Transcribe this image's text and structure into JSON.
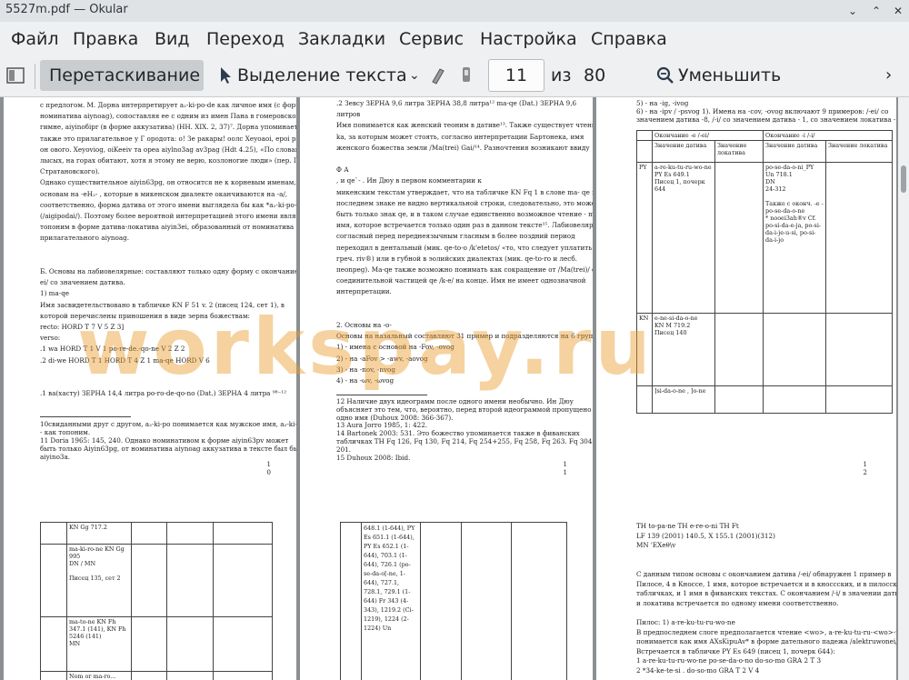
{
  "window": {
    "title": "5527m.pdf — Okular"
  },
  "menu": [
    "Файл",
    "Правка",
    "Вид",
    "Переход",
    "Закладки",
    "Сервис",
    "Настройка",
    "Справка"
  ],
  "toolbar": {
    "drag": "Перетаскивание",
    "select_text": "Выделение текста",
    "page_current": "11",
    "page_of": "из",
    "page_total": "80",
    "zoom_out": "Уменьшить"
  },
  "watermark": "workspay.ru",
  "pages": {
    "p1": {
      "lines": [
        "с предлогом. М. Дорна интерпретирует a₂-ki-po-de как личное имя (с формой",
        "номинатива aiynoag), сопоставляя ее с одним из имен Пана в гомеровском",
        "гимне, aiyinoбipr (в форме аккузатива) (HH. XIX. 2, 37)⁷. Дорна упоминает",
        "также это прилагательное у Г ородота: о! Зе ракары! оолс Хеуоаоі, ероі рєv",
        "он ового. Xeyoviog, oiKeeiv та ореа aiylno3ag av3pag (Hdt 4.25), «По словам",
        "лысых, на горах обитают, хотя я этому не верю, козлоногие люди» (пер. Г.А.",
        "Стратановского).",
        "Однако существительное aiyin63pg, он относится не к корневым именам, а к",
        "основам на -eH₂- , которые в микенском диалекте оканчиваются на -a/,",
        "соответственно, форма датива от этого имени выглядела бы как *a₂-ki-po-da",
        "(/aigipodai/). Поэтому более вероятной интерпретацией этого имени является",
        "топоним в форме датива-локатива aiyin3ei, образованный от номинатива",
        "прилагательного aiynoag.",
        "",
        "",
        "Б. Основы на лабиовелярные: составляют только одну форму с окончанием /-",
        "ei/ со значением датива.",
        "1) ma-qe",
        "Имя засвидетельствовано в табличке KN F 51 v. 2 (писец 124, сет 1), в",
        "которой перечислены приношения в виде зерна божествам:",
        "recto:        HORD T 7 V 5 Z 3]",
        "verso:",
        ".1        wa HORD T 1 V 1              po-re-de.-qo-ne    V 2 Z 2",
        ".2 di-we HORD T 1 HORD T 4 Z 1 ma-qe HORD V 6",
        "",
        "",
        ".1 ва(хасту) ЗЕРНА 14,4 литра po-ro-de-qo-no (Dat.) ЗЕРНА 4 литра ⁹⁸⁻¹²"
      ],
      "notes": [
        "10свиданными друг с другом, a₂-ki-po понимается как мужское имя, a₂-ki-po-de",
        "- как топоним.",
        "11      Doria 1965: 145, 240. Однако номинативом к форме aiyin63pv может",
        "быть только Aiyin63pg, от номинатива aiynoag аккузатива в тексте был бы",
        "aiyino3a."
      ],
      "page_number": [
        "1",
        "0"
      ]
    },
    "p2": {
      "lines": [
        ".2 Зевсу ЗЕРНА 9,6 литра ЗЕРНА 38,8 литра¹²         ma-qe       (Dat.) ЗЕРНА 9,6",
        "литров",
        "Имя понимается как женский теоним в дативе¹³. Также существует чтение ma-",
        "ka, за которым может стоять, согласно интерпретации Бартонека, имя",
        "женского божества земли /Ma(trei) Gai/¹⁴. Разночтения возникают ввиду",
        "",
        "                           Ф           А",
        "              ,                               и qe`-        . Ин Дюу в первом комментарии к",
        "микенским текстам утверждает, что на табличке KN Fq 1 в слове ma- qe в",
        "последнем знаке не видно вертикальной строки, следовательно, это может",
        "быть только знак qe, и в таком случае единственно возможное чтение - ma-qe,",
        "имя, которое встречается только один раз в данном тексте¹⁵. Лабиовелярный",
        "согласный перед переднеязычным гласным в более поздний период",
        "переходил в дентальный (мик. qe-to-o /k'etetos/ «то, что следует уплатить» и",
        "греч. riv®) или в губной в эолийских диалектах (мик. qe-to-ro и лесб.",
        "πeonpeg). Ма-qe также возможно понимать как сокращение от /Ma(trei)/ с",
        "соединительной частицей qe /k-e/ на конце. Имя не имеет однозначной",
        "интерпретации.",
        "",
        "",
        "2.   Основы на -o-",
        "Основы на назальный составляют 31 пример и подразделяются на 6 групп:",
        "1) - имена с основой на -Fov, -ovog",
        "2)       - на -aFov > -awv, -aovog",
        "3)       - на -nov, -nvog",
        "4)       - на -ωv, -ωvog"
      ],
      "notes": [
        "12      Наличие двух идеограмм после одного имени необычно. Ин Дюу",
        "объясняет это тем, что, вероятно, перед второй идеограммой пропущено еще",
        "одно имя (Duhoux 2008: 366-367).",
        "13      Aura Jorro 1985, 1: 422.",
        "14      Bartonek 2003: 531. Это божество упоминается также в фиванских",
        "табличках TH Fq 126, Fq 130, Fq 214, Fq 254+255, Fq 258, Fq 263. Fq 304, Gp",
        "201.",
        "15      Duhoux 2008: Ibid."
      ],
      "page_number": [
        "1",
        "1"
      ]
    },
    "p3": {
      "lines": [
        "5)   - на -ig, -ivog",
        "6)   - на -ipv / -psvog 1). Имена на -cov, -ovog  включают 9 примеров: /-ei/ со",
        "значением датива -8, /-i/ со значением датива - 1, со значением локатива - 1."
      ],
      "table": {
        "head1": [
          "",
          "Окончание -e /-ei/",
          "",
          "Окончание -i /-i/",
          ""
        ],
        "head2": [
          "",
          "Значение датива",
          "Значение локатива",
          "Значение датива",
          "Значение локатива"
        ],
        "row1": [
          "PY",
          "a-re-ku-tu-ru-wo-ne\nPY Es 649.1\nПисец 1, почерк 644",
          "",
          "po-se-da-o-ni_PY Un 718.1\nDN\n24-312\n\nТакже с оконч. -e - po-se-da-o-ne\n* nooei3ah®v Cf. po-si-da-e-ja, po-si-da-i-je-u-si, po-si-da-i-jo",
          ""
        ],
        "row2": [
          "KN",
          "e-ne-si-da-o-ne\nKN M 719.2\nПисец 140",
          "",
          "",
          ""
        ],
        "row3": [
          "",
          "]si-da-o-ne , ]o-ne",
          "",
          "",
          ""
        ]
      },
      "page_number": [
        "1",
        "2"
      ]
    },
    "p4": {
      "cells": [
        "KN Gg 717.2",
        "ma-ki-ro-ne KN Gg 995\nDN / MN\n\nПисец 135, сет 2",
        "ma-to-ne KN Fh 347.1 (141), KN Fh 5246 (141)\nMN",
        "Nom or ma-ro..."
      ]
    },
    "p5": {
      "cells": [
        "648.1 (1-644), PY Es 651.1 (1-644), PY Es 652.1 (1-644), 703.1 (1-644), 726.1 (po-se-da-o[-ne, 1-644), 727.1, 728.1, 729.1 (1-644) Fr 343 (4-343), 1219.2 (Ci-1219), 1224 (2-1224) Un"
      ]
    },
    "p6": {
      "lines": [
        "TH    to-pa-ne    TH                                               e-re-o-ni TH Ft",
        "        LF 139 (2001)                                    140.5, X 155.1 (2001)(312)",
        "        MN                                                          'EXeθ\\v",
        "",
        "",
        "С данным типом основы с окончанием датива /-ei/ обнаружен 1 пример в",
        "Пилосе, 4 в Кноссе, 1 имя, которое встречается и в кноссских, и в пилосских",
        "табличках, и 1 имя в фиванских текстах. С окончанием /-i/ в значении датива",
        "и локатива встречается по одному имени соответственно.",
        "",
        "Пилос: 1) a-re-ku-tu-ru-wo-ne",
        "В предпоследнем слоге предполагается чтение <wo>, a-re-ku-tu-ru-<wo>-ne",
        "понимается как имя AXsKipuAv* в форме дательного падежа /alektruwonei/.",
        "Встречается в табличке PY Es 649 (писец 1, почерк 644):",
        "1            a-re-ku-tu-ru-wo-ne po-se-da-o-no do-so-mo       GRA 2    T   3",
        "2       *34-ke-te-si . do-so-mo                                   GRA    T   2 V 4"
      ]
    }
  }
}
